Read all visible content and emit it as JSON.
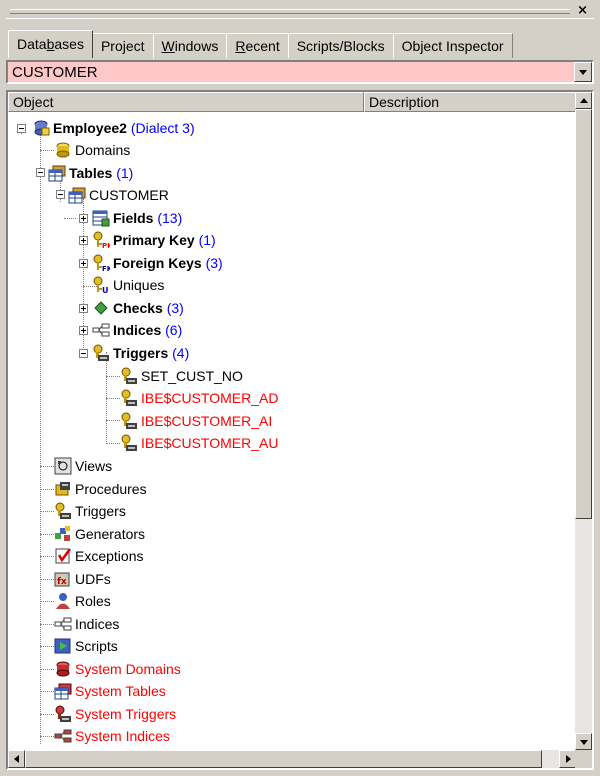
{
  "window": {
    "close_glyph": "×"
  },
  "tabs": [
    {
      "label": "Databases",
      "accel": "b",
      "active": true
    },
    {
      "label": "Project",
      "active": false
    },
    {
      "label": "Windows",
      "accel": "W",
      "active": false
    },
    {
      "label": "Recent",
      "accel": "R",
      "active": false
    },
    {
      "label": "Scripts/Blocks",
      "active": false
    },
    {
      "label": "Object Inspector",
      "active": false
    }
  ],
  "object_combo": {
    "value": "CUSTOMER",
    "background": "#ffc8c8"
  },
  "columns": {
    "object": "Object",
    "description": "Description"
  },
  "colors": {
    "link_blue": "#0000ff",
    "system_red": "#ff0000",
    "tree_line": "#808080"
  },
  "tree": {
    "db": {
      "name": "Employee2",
      "dialect": "(Dialect 3)",
      "icon": "database-icon"
    },
    "domains": {
      "name": "Domains",
      "icon": "domain-icon"
    },
    "tables": {
      "name": "Tables",
      "count": "(1)",
      "icon": "tables-icon"
    },
    "customer": {
      "name": "CUSTOMER",
      "icon": "table-icon"
    },
    "fields": {
      "name": "Fields",
      "count": "(13)",
      "icon": "fields-icon"
    },
    "primary_key": {
      "name": "Primary Key",
      "count": "(1)",
      "icon": "primary-key-icon"
    },
    "foreign_keys": {
      "name": "Foreign Keys",
      "count": "(3)",
      "icon": "foreign-key-icon"
    },
    "uniques": {
      "name": "Uniques",
      "icon": "unique-key-icon"
    },
    "checks": {
      "name": "Checks",
      "count": "(3)",
      "icon": "check-icon"
    },
    "indices": {
      "name": "Indices",
      "count": "(6)",
      "icon": "index-icon"
    },
    "triggers": {
      "name": "Triggers",
      "count": "(4)",
      "icon": "trigger-icon"
    },
    "trigger_items": [
      {
        "name": "SET_CUST_NO",
        "system": false
      },
      {
        "name": "IBE$CUSTOMER_AD",
        "system": true
      },
      {
        "name": "IBE$CUSTOMER_AI",
        "system": true
      },
      {
        "name": "IBE$CUSTOMER_AU",
        "system": true
      }
    ],
    "db_items": [
      {
        "name": "Views",
        "icon": "views-icon",
        "system": false
      },
      {
        "name": "Procedures",
        "icon": "procedures-icon",
        "system": false
      },
      {
        "name": "Triggers",
        "icon": "trigger-icon",
        "system": false
      },
      {
        "name": "Generators",
        "icon": "generators-icon",
        "system": false
      },
      {
        "name": "Exceptions",
        "icon": "exceptions-icon",
        "system": false
      },
      {
        "name": "UDFs",
        "icon": "udf-icon",
        "system": false
      },
      {
        "name": "Roles",
        "icon": "roles-icon",
        "system": false
      },
      {
        "name": "Indices",
        "icon": "index-icon",
        "system": false
      },
      {
        "name": "Scripts",
        "icon": "scripts-icon",
        "system": false
      },
      {
        "name": "System Domains",
        "icon": "domain-icon",
        "system": true
      },
      {
        "name": "System Tables",
        "icon": "tables-icon",
        "system": true
      },
      {
        "name": "System Triggers",
        "icon": "trigger-icon",
        "system": true
      },
      {
        "name": "System Indices",
        "icon": "index-icon",
        "system": true
      }
    ]
  }
}
